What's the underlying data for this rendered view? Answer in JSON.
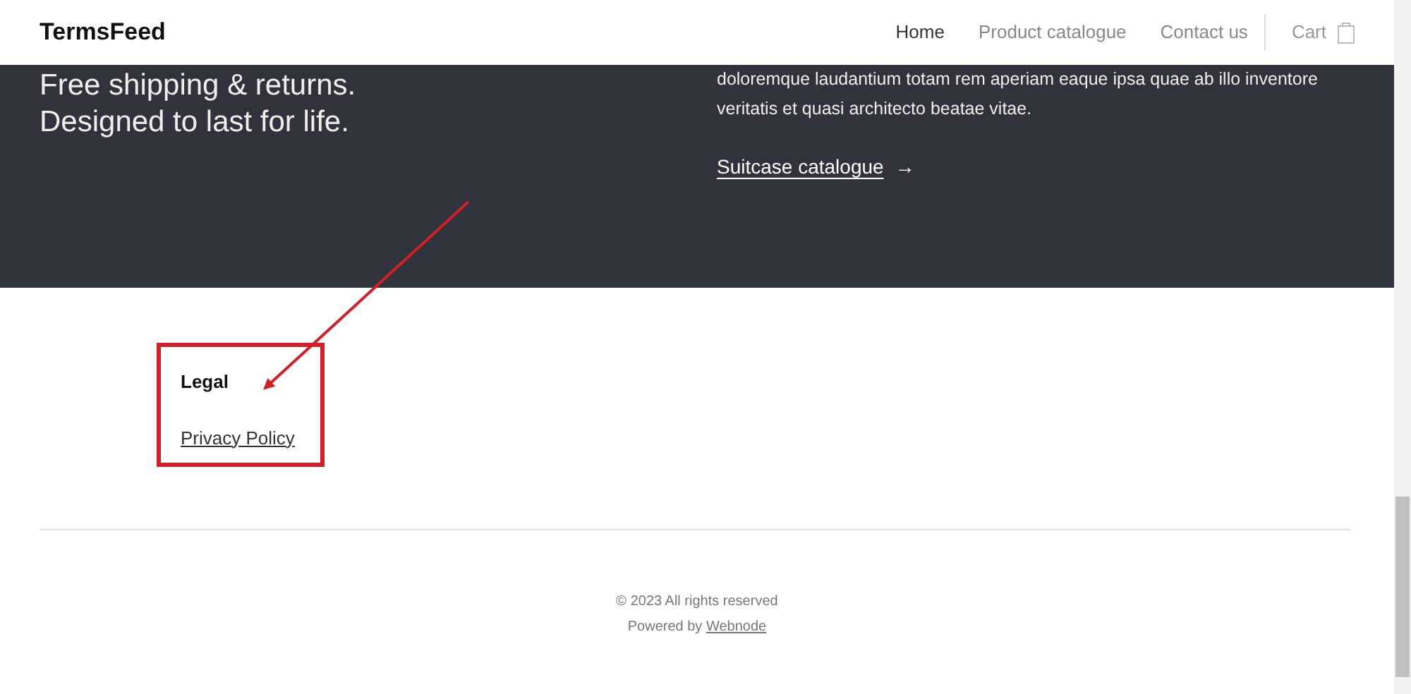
{
  "navbar": {
    "brand": "TermsFeed",
    "links": [
      {
        "label": "Home",
        "selected": true
      },
      {
        "label": "Product catalogue",
        "selected": false
      },
      {
        "label": "Contact us",
        "selected": false
      }
    ],
    "cart": "Cart"
  },
  "hero": {
    "headline_lines": [
      "Free shipping & returns.",
      "Designed to last for life."
    ],
    "paragraph_lines": [
      "doloremque laudantium totam rem aperiam eaque ipsa quae ab illo inventore",
      "veritatis et quasi architecto beatae vitae."
    ],
    "link": "Suitcase catalogue",
    "link_arrow": "→"
  },
  "footer": {
    "heading": "Legal",
    "links": [
      "Privacy Policy"
    ],
    "copyright": "© 2023 All rights reserved",
    "powered_by": "Powered by",
    "powered_link": "Webnode"
  }
}
